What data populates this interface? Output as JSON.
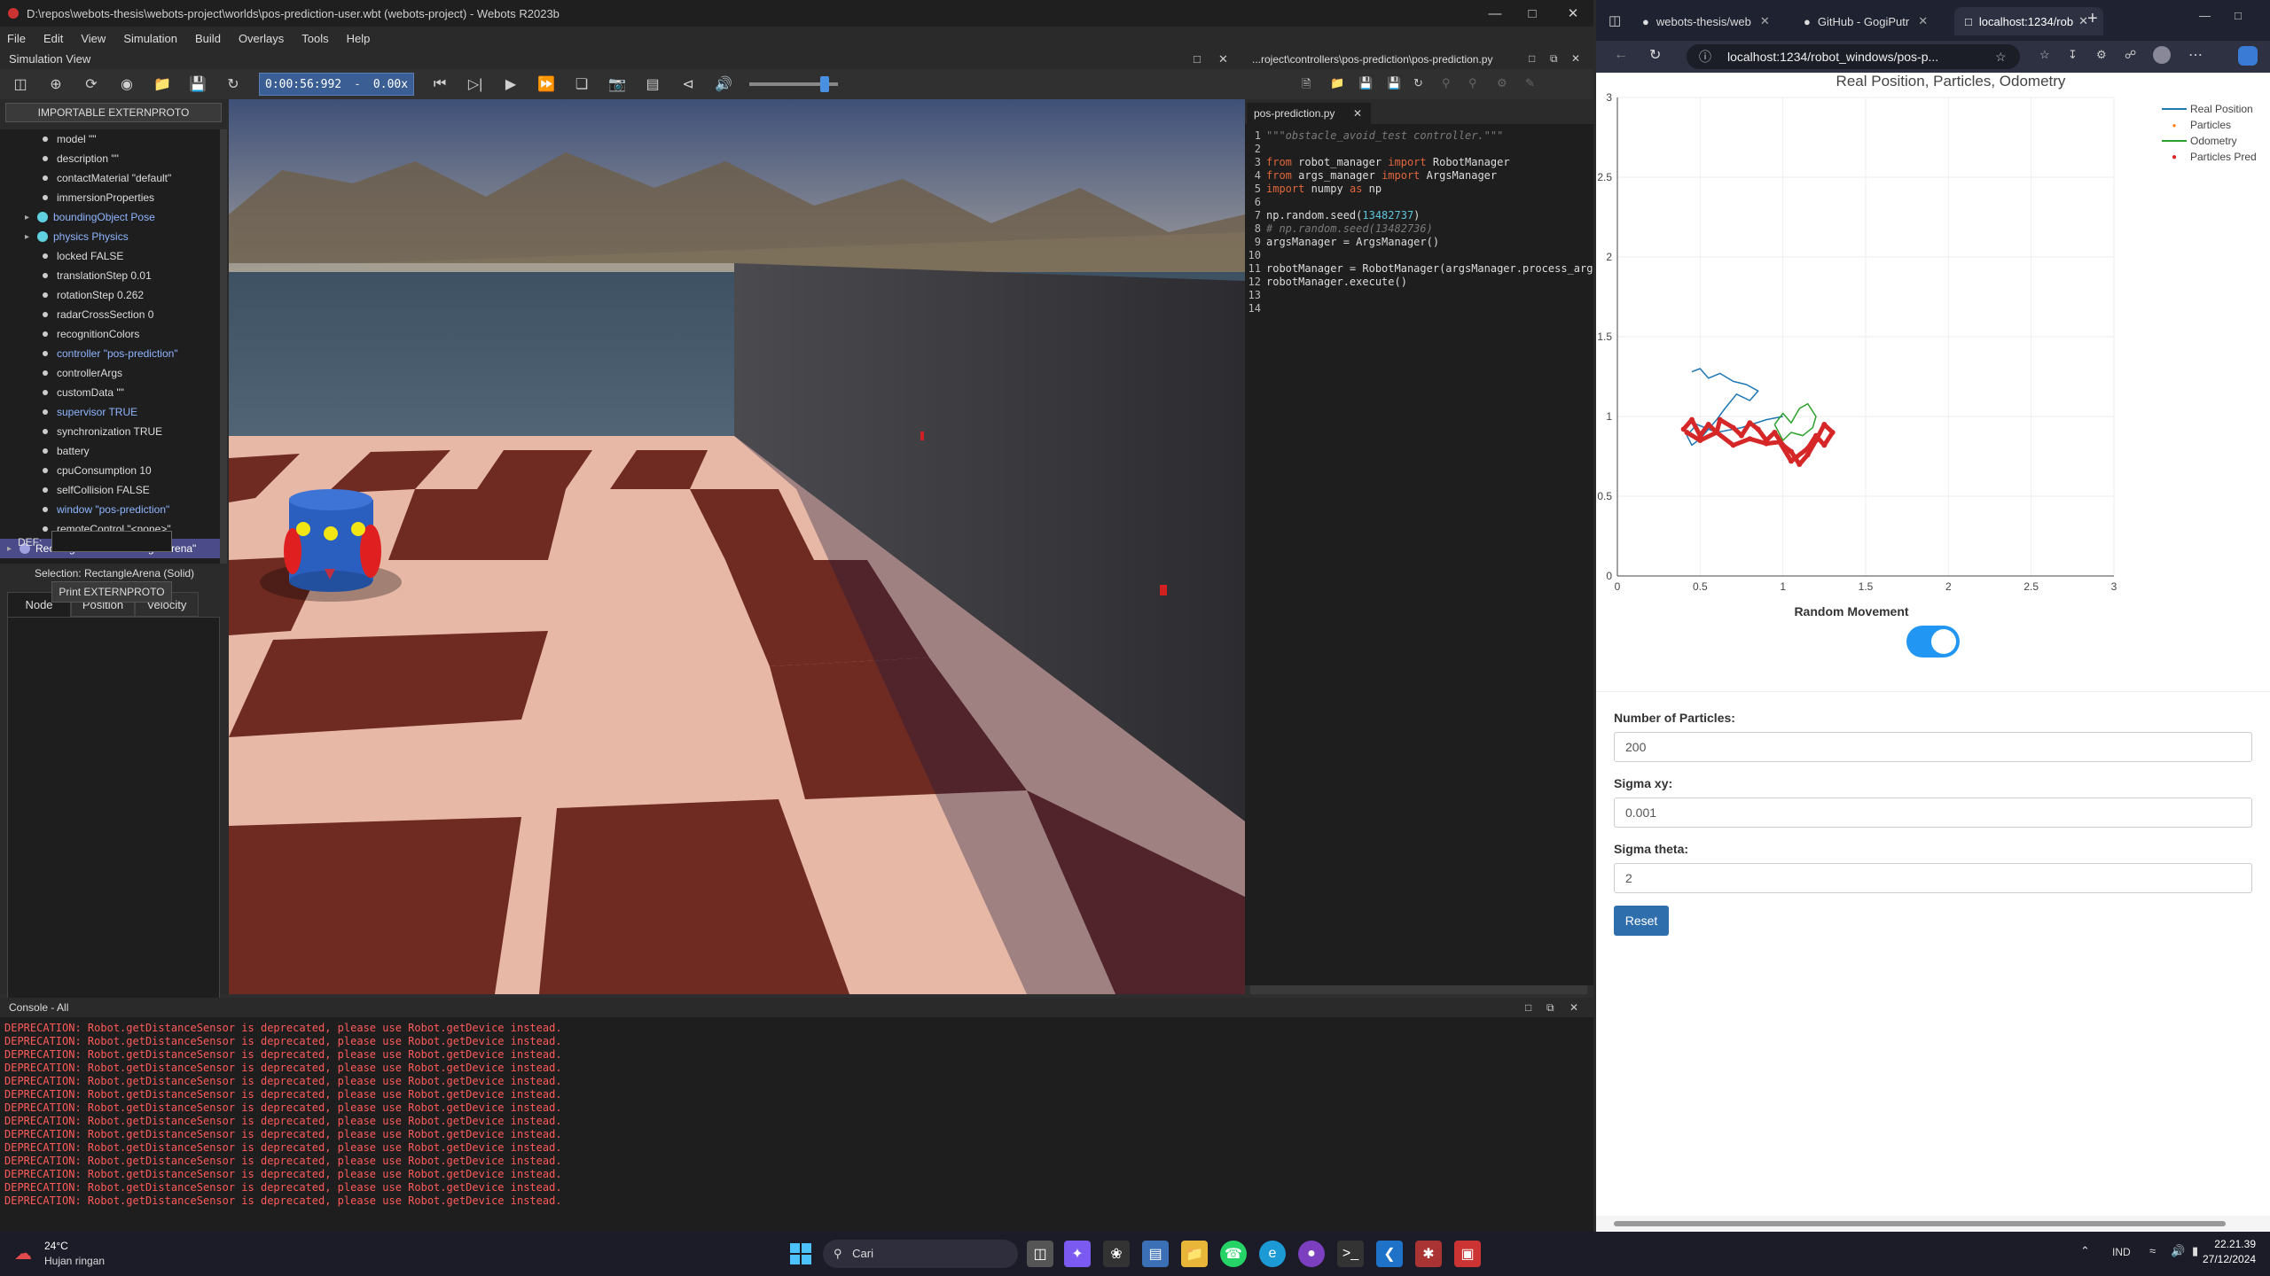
{
  "webots": {
    "title": "D:\\repos\\webots-thesis\\webots-project\\worlds\\pos-prediction-user.wbt (webots-project) - Webots R2023b",
    "menu": [
      "File",
      "Edit",
      "View",
      "Simulation",
      "Build",
      "Overlays",
      "Tools",
      "Help"
    ],
    "sim_view_label": "Simulation View",
    "sim_time": "0:00:56:992",
    "sim_speed": "0.00x",
    "volume_level_pct": 80,
    "importable_btn": "IMPORTABLE EXTERNPROTO",
    "tree": [
      {
        "label": "model \"\"",
        "style": "dot"
      },
      {
        "label": "description \"\"",
        "style": "dot"
      },
      {
        "label": "contactMaterial \"default\"",
        "style": "dot"
      },
      {
        "label": "immersionProperties",
        "style": "dot"
      },
      {
        "label": "boundingObject Pose",
        "style": "ball-blue"
      },
      {
        "label": "physics Physics",
        "style": "ball-blue"
      },
      {
        "label": "locked FALSE",
        "style": "dot"
      },
      {
        "label": "translationStep 0.01",
        "style": "dot"
      },
      {
        "label": "rotationStep 0.262",
        "style": "dot"
      },
      {
        "label": "radarCrossSection 0",
        "style": "dot"
      },
      {
        "label": "recognitionColors",
        "style": "dot"
      },
      {
        "label": "controller \"pos-prediction\"",
        "style": "dot-blue"
      },
      {
        "label": "controllerArgs",
        "style": "dot"
      },
      {
        "label": "customData \"\"",
        "style": "dot"
      },
      {
        "label": "supervisor TRUE",
        "style": "dot-blue"
      },
      {
        "label": "synchronization TRUE",
        "style": "dot"
      },
      {
        "label": "battery",
        "style": "dot"
      },
      {
        "label": "cpuConsumption 10",
        "style": "dot"
      },
      {
        "label": "selfCollision FALSE",
        "style": "dot"
      },
      {
        "label": "window \"pos-prediction\"",
        "style": "dot-blue"
      },
      {
        "label": "remoteControl \"<none>\"",
        "style": "dot"
      },
      {
        "label": "RectangleArena \"rectangle arena\"",
        "style": "selected"
      }
    ],
    "selection": "Selection: RectangleArena (Solid)",
    "field_tabs": [
      "Node",
      "Position",
      "Velocity"
    ],
    "def_label": "DEF:",
    "print_btn": "Print EXTERNPROTO"
  },
  "editor": {
    "path": "...roject\\controllers\\pos-prediction\\pos-prediction.py",
    "tab": "pos-prediction.py",
    "lines": [
      {
        "n": "1",
        "parts": [
          {
            "t": "\"\"\"obstacle_avoid_test controller.\"\"\"",
            "c": "cm"
          }
        ]
      },
      {
        "n": "2",
        "parts": []
      },
      {
        "n": "3",
        "parts": [
          {
            "t": "from",
            "c": "kw"
          },
          {
            "t": " robot_manager ",
            "c": ""
          },
          {
            "t": "import",
            "c": "kw"
          },
          {
            "t": " RobotManager",
            "c": ""
          }
        ]
      },
      {
        "n": "4",
        "parts": [
          {
            "t": "from",
            "c": "kw"
          },
          {
            "t": " args_manager ",
            "c": ""
          },
          {
            "t": "import",
            "c": "kw"
          },
          {
            "t": " ArgsManager",
            "c": ""
          }
        ]
      },
      {
        "n": "5",
        "parts": [
          {
            "t": "import",
            "c": "kw"
          },
          {
            "t": " numpy ",
            "c": ""
          },
          {
            "t": "as",
            "c": "kw"
          },
          {
            "t": " np",
            "c": ""
          }
        ]
      },
      {
        "n": "6",
        "parts": []
      },
      {
        "n": "7",
        "parts": [
          {
            "t": "np.random.seed(",
            "c": ""
          },
          {
            "t": "13482737",
            "c": "num"
          },
          {
            "t": ")",
            "c": ""
          }
        ]
      },
      {
        "n": "8",
        "parts": [
          {
            "t": "# np.random.seed(13482736)",
            "c": "cm"
          }
        ]
      },
      {
        "n": "9",
        "parts": [
          {
            "t": "argsManager = ArgsManager()",
            "c": ""
          }
        ]
      },
      {
        "n": "10",
        "parts": []
      },
      {
        "n": "11",
        "parts": [
          {
            "t": "robotManager = RobotManager(argsManager.process_args(",
            "c": ""
          }
        ]
      },
      {
        "n": "12",
        "parts": [
          {
            "t": "robotManager.execute()",
            "c": ""
          }
        ]
      },
      {
        "n": "13",
        "parts": []
      },
      {
        "n": "14",
        "parts": []
      }
    ]
  },
  "console": {
    "title": "Console - All",
    "line": "DEPRECATION: Robot.getDistanceSensor is deprecated, please use Robot.getDevice instead.",
    "count": 14
  },
  "browser": {
    "tabs": [
      "webots-thesis/web",
      "GitHub - GogiPutr",
      "localhost:1234/rob"
    ],
    "url": "localhost:1234/robot_windows/pos-p...",
    "plot_title": "Real Position, Particles, Odometry",
    "legend": [
      "Real Position",
      "Particles",
      "Odometry",
      "Particles Pred"
    ],
    "toggle_label": "Random Movement",
    "toggle_on": true,
    "fields": [
      {
        "label": "Number of Particles:",
        "value": "200"
      },
      {
        "label": "Sigma xy:",
        "value": "0.001"
      },
      {
        "label": "Sigma theta:",
        "value": "2"
      }
    ],
    "reset_btn": "Reset"
  },
  "chart_data": {
    "type": "line",
    "title": "Real Position, Particles, Odometry",
    "xlim": [
      0,
      3
    ],
    "ylim": [
      0,
      3
    ],
    "x_ticks": [
      "0",
      "0.5",
      "1",
      "1.5",
      "2",
      "2.5",
      "3"
    ],
    "y_ticks": [
      "0",
      "0.5",
      "1",
      "1.5",
      "2",
      "2.5",
      "3"
    ],
    "legend_position": "top-right",
    "series": [
      {
        "name": "Real Position",
        "color": "#1f77b4",
        "x": [
          0.45,
          0.5,
          0.55,
          0.62,
          0.7,
          0.78,
          0.85,
          0.8,
          0.72,
          0.65,
          0.6,
          0.55,
          0.5,
          0.45,
          0.42,
          0.48,
          0.6,
          0.75,
          0.9,
          1.0
        ],
        "y": [
          1.28,
          1.3,
          1.24,
          1.27,
          1.22,
          1.2,
          1.16,
          1.1,
          1.14,
          1.05,
          0.98,
          0.92,
          0.86,
          0.82,
          0.88,
          0.95,
          0.9,
          0.93,
          0.98,
          1.0
        ]
      },
      {
        "name": "Odometry",
        "color": "#2ca02c",
        "x": [
          0.95,
          1.0,
          1.05,
          1.1,
          1.15,
          1.2,
          1.18,
          1.12,
          1.05,
          1.0,
          0.95
        ],
        "y": [
          0.95,
          1.02,
          0.96,
          1.05,
          1.08,
          1.0,
          0.93,
          0.88,
          0.9,
          0.85,
          0.95
        ]
      },
      {
        "name": "Particles Pred",
        "color": "#d62728",
        "x": [
          0.4,
          0.45,
          0.5,
          0.55,
          0.6,
          0.62,
          0.7,
          0.75,
          0.8,
          0.85,
          0.9,
          0.95,
          1.0,
          1.05,
          1.1,
          1.15,
          1.2,
          1.25,
          1.3,
          1.25,
          1.2,
          1.15,
          1.05,
          0.98,
          0.9,
          0.8,
          0.7,
          0.6,
          0.5,
          0.42
        ],
        "y": [
          0.92,
          0.98,
          0.88,
          0.95,
          0.9,
          0.98,
          0.93,
          0.88,
          0.96,
          0.92,
          0.85,
          0.9,
          0.82,
          0.78,
          0.7,
          0.76,
          0.85,
          0.95,
          0.9,
          0.82,
          0.88,
          0.8,
          0.72,
          0.84,
          0.83,
          0.86,
          0.82,
          0.9,
          0.85,
          0.9
        ]
      }
    ]
  },
  "taskbar": {
    "temp": "24°C",
    "weather": "Hujan ringan",
    "search": "Cari",
    "lang": "IND",
    "time": "22.21.39",
    "date": "27/12/2024"
  }
}
